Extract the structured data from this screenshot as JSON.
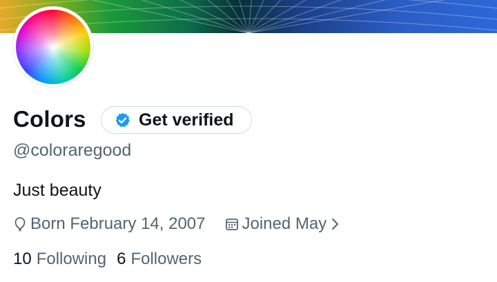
{
  "profile": {
    "display_name": "Colors",
    "handle": "@coloraregood",
    "bio": "Just beauty",
    "verify_button_label": "Get verified",
    "birth": "Born February 14, 2007",
    "joined": "Joined May",
    "following_count": "10",
    "following_label": "Following",
    "followers_count": "6",
    "followers_label": "Followers"
  },
  "icons": {
    "verified": "verified-badge-icon",
    "birth": "balloon-icon",
    "joined": "calendar-icon",
    "chevron": "chevron-right-icon"
  },
  "colors": {
    "accent": "#1d9bf0",
    "secondary_text": "#536471",
    "primary_text": "#0f1419"
  }
}
